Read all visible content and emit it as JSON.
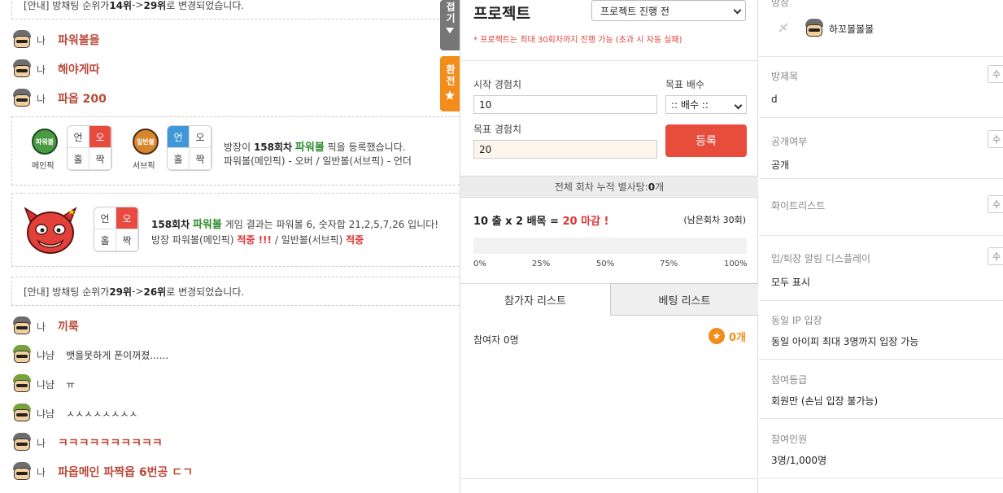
{
  "chat": {
    "notice1": {
      "prefix": "[안내] 방채팅 순위가 ",
      "from": "14위",
      "mid": " -> ",
      "to": "29위",
      "suffix": " 로 변경되었습니다."
    },
    "messages_top": [
      {
        "nick": "나",
        "text": "파워볼을"
      },
      {
        "nick": "나",
        "text": "해야게따"
      },
      {
        "nick": "나",
        "text": "파옵 200"
      }
    ],
    "pick": {
      "main_ball": "파워볼",
      "main_caption": "메인픽",
      "sub_ball": "일반볼",
      "sub_caption": "서브픽",
      "cells": [
        "언",
        "오",
        "홀",
        "짝"
      ],
      "line1_prefix": "방장이 ",
      "round": "158회차",
      "game": "파워볼",
      "line1_suffix": " 픽을 등록했습니다.",
      "line2": "파워볼(메인픽) - 오버 / 일반볼(서브픽) - 언더"
    },
    "result": {
      "round": "158회차",
      "game": "파워볼",
      "line1_suffix": " 게임 결과는 파워볼 6, 숫자합 21,2,5,7,26 입니다!",
      "line2_prefix": "방장 파워볼(메인픽) ",
      "hit1": "적중 !!!",
      "line2_mid": " / 일반볼(서브픽) ",
      "hit2": "적중",
      "cells": [
        "언",
        "오",
        "홀",
        "짝"
      ]
    },
    "notice2": {
      "prefix": "[안내] 방채팅 순위가 ",
      "from": "29위",
      "mid": " -> ",
      "to": "26위",
      "suffix": " 로 변경되었습니다."
    },
    "messages_bottom": [
      {
        "nick": "나",
        "text": "끼룩",
        "style": "bold"
      },
      {
        "nick": "냐냠",
        "text": "뱃을못하게 폰이꺼졌......",
        "style": "plain"
      },
      {
        "nick": "냐냠",
        "text": "ㅠ",
        "style": "plain"
      },
      {
        "nick": "냐냠",
        "text": "ㅅㅅㅅㅅㅅㅅㅅㅅ",
        "style": "plain"
      },
      {
        "nick": "나",
        "text": "ㅋㅋㅋㅋㅋㅋㅋㅋㅋㅋ",
        "style": "bold"
      },
      {
        "nick": "나",
        "text": "파옵메인 파짝옵 6번공 ㄷㄱ",
        "style": "bold"
      }
    ],
    "fold_tab": "접기",
    "charge_tab": "환전"
  },
  "project": {
    "title": "프로젝트",
    "status": "프로젝트 진행 전",
    "note": "* 프로젝트는 최대 30회차까지 진행 가능 (초과 시 자동 실패)",
    "start_exp_label": "시작 경험치",
    "start_exp": "10",
    "target_mult_label": "목표 배수",
    "target_mult": ":: 배수 ::",
    "target_exp_label": "목표 경험치",
    "target_exp": "20",
    "register": "등록",
    "total_prefix": "전체 회차 누적 별사탕: ",
    "total_value": "0",
    "total_suffix": "개",
    "goal_prefix": "10 출 x 2 배목 = ",
    "goal_highlight": "20 마감 !",
    "remaining": "(남은회차 30회)",
    "progress": 0,
    "ticks": [
      "0%",
      "25%",
      "50%",
      "75%",
      "100%"
    ],
    "tab_participants": "참가자 리스트",
    "tab_bets": "베팅 리스트",
    "participants": "참여자 0명",
    "coins": "0개"
  },
  "room": {
    "host_label": "방장",
    "host_name": "하꼬볼볼볼",
    "title_label": "방제목",
    "title_value": "d",
    "public_label": "공개여부",
    "public_value": "공개",
    "whitelist_label": "화이트리스트",
    "display_label": "입/퇴장 알림 디스플레이",
    "display_value": "모두 표시",
    "ip_label": "동일 IP 입장",
    "ip_value": "동일 아이피 최대 3명까지 입장 가능",
    "grade_label": "참여등급",
    "grade_value": "회원만 (손님 입장 불가능)",
    "members_label": "참여인원",
    "members_value": "3명/1,000명",
    "edit_label": "수"
  },
  "colors": {
    "accent_red": "#e84c3d",
    "accent_orange": "#f28d1b",
    "hit_green": "#2e8b2e"
  }
}
